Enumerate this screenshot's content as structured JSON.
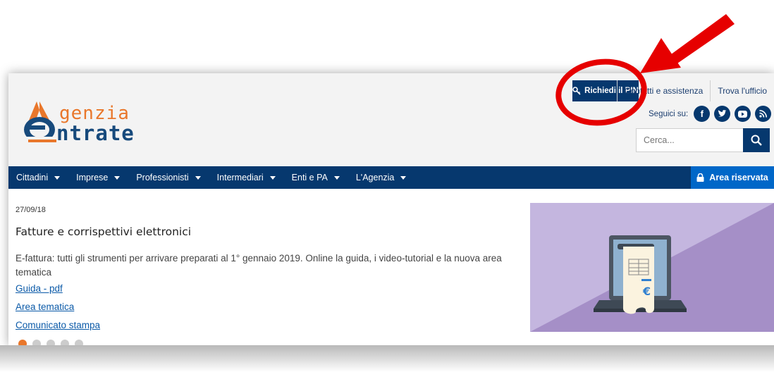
{
  "header": {
    "pin_button": "Richiedi il PIN",
    "util_links": [
      "Contatti e assistenza",
      "Trova l'ufficio"
    ],
    "social_label": "Seguici su:",
    "social_icons": [
      "facebook-icon",
      "twitter-icon",
      "youtube-icon",
      "rss-icon"
    ],
    "search_placeholder": "Cerca...",
    "logo": {
      "line1": "genzia",
      "line2": "ntrate"
    }
  },
  "nav": {
    "items": [
      "Cittadini",
      "Imprese",
      "Professionisti",
      "Intermediari",
      "Enti e PA",
      "L'Agenzia"
    ],
    "area_riservata": "Area riservata"
  },
  "news": {
    "date": "27/09/18",
    "title": "Fatture e corrispettivi elettronici",
    "description": "E-fattura: tutti gli strumenti per arrivare preparati al 1° gennaio 2019. Online la guida, i video-tutorial e la nuova area tematica",
    "links": [
      "Guida - pdf",
      "Area tematica",
      "Comunicato stampa"
    ]
  },
  "colors": {
    "brand_blue": "#06386e",
    "accent_orange": "#e9772b",
    "area_riservata_blue": "#0067c8",
    "annotation_red": "#e60000",
    "illustration_bg": "#b9a9d6"
  }
}
